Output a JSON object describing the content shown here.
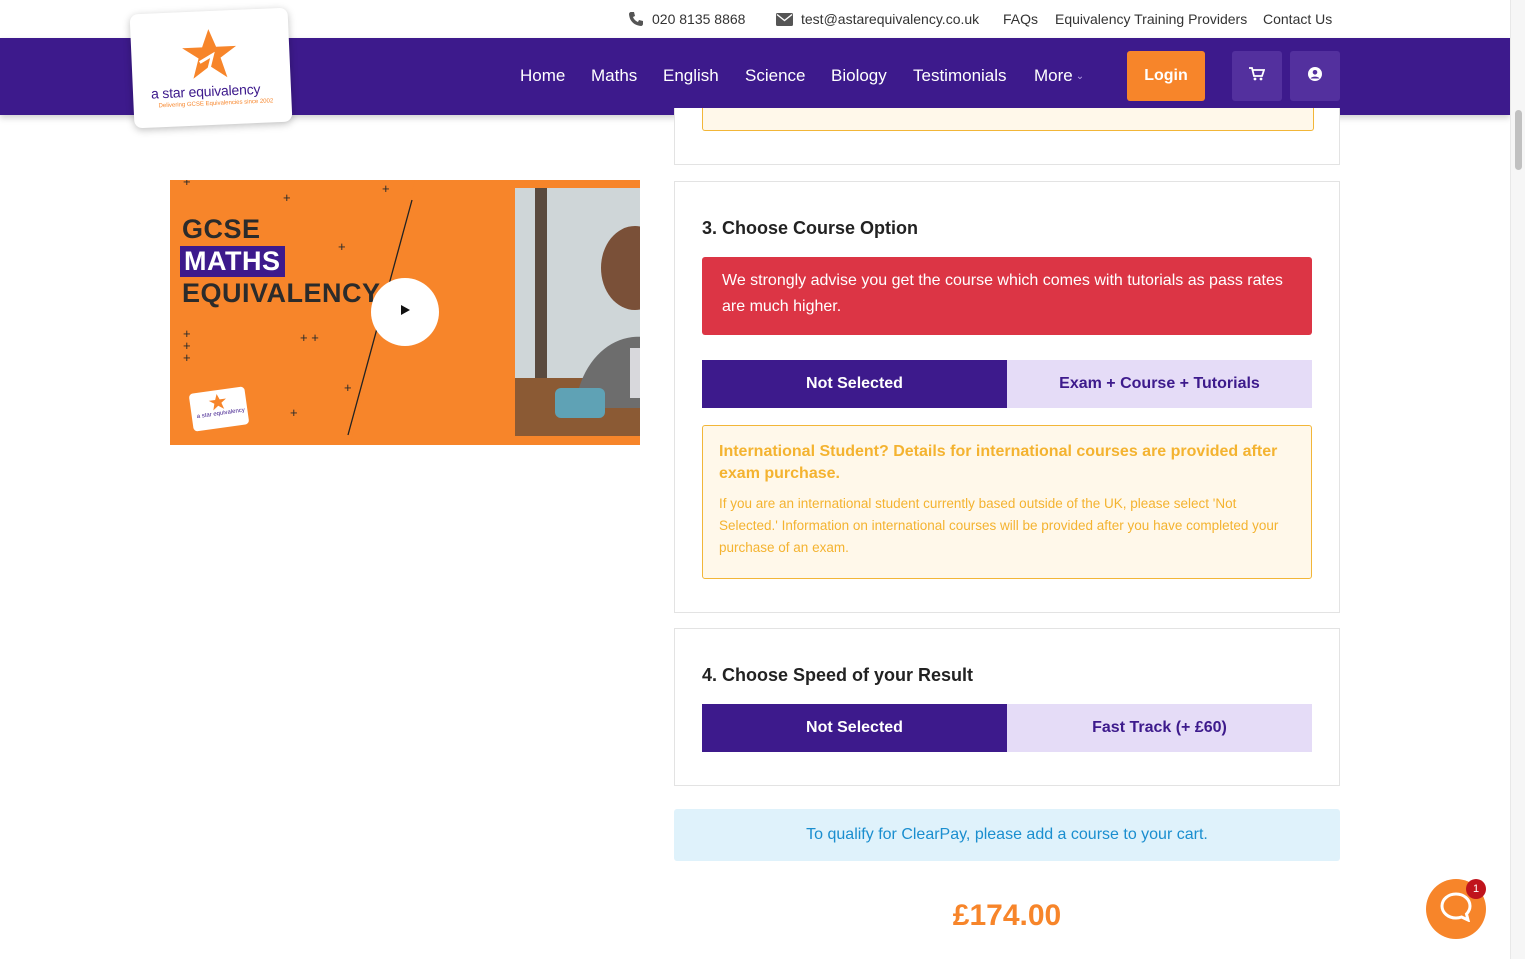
{
  "topbar": {
    "phone": "020 8135 8868",
    "email": "test@astarequivalency.co.uk",
    "links": [
      "FAQs",
      "Equivalency Training Providers",
      "Contact Us"
    ]
  },
  "logo": {
    "name": "a star equivalency",
    "tagline": "Delivering GCSE Equivalencies since 2002"
  },
  "nav": {
    "links": [
      "Home",
      "Maths",
      "English",
      "Science",
      "Biology",
      "Testimonials",
      "More"
    ],
    "login_label": "Login",
    "icons": [
      "cart-icon",
      "user-icon"
    ]
  },
  "video": {
    "line1": "GCSE",
    "line2": "MATHS",
    "line3": "EQUIVALENCY",
    "mini_logo": "a star equivalency"
  },
  "course_option": {
    "title": "3. Choose Course Option",
    "advice": "We strongly advise you get the course which comes with tutorials as pass rates are much higher.",
    "options": [
      "Not Selected",
      "Exam + Course + Tutorials"
    ],
    "selected_index": 0,
    "international_heading": "International Student? Details for international courses are provided after exam purchase.",
    "international_body": "If you are an international student currently based outside of the UK, please select 'Not Selected.' Information on international courses will be provided after you have completed your purchase of an exam."
  },
  "speed": {
    "title": "4. Choose Speed of your Result",
    "options": [
      "Not Selected",
      "Fast Track (+ £60)"
    ],
    "selected_index": 0
  },
  "clearpay_notice": "To qualify for ClearPay, please add a course to your cart.",
  "price": "£174.00",
  "chat": {
    "badge_count": "1"
  },
  "colors": {
    "brand_purple": "#3d1a8c",
    "brand_orange": "#f7852a",
    "alert_red": "#dc3545",
    "warning_yellow": "#f4b330",
    "info_blue": "#1a8ecf"
  }
}
